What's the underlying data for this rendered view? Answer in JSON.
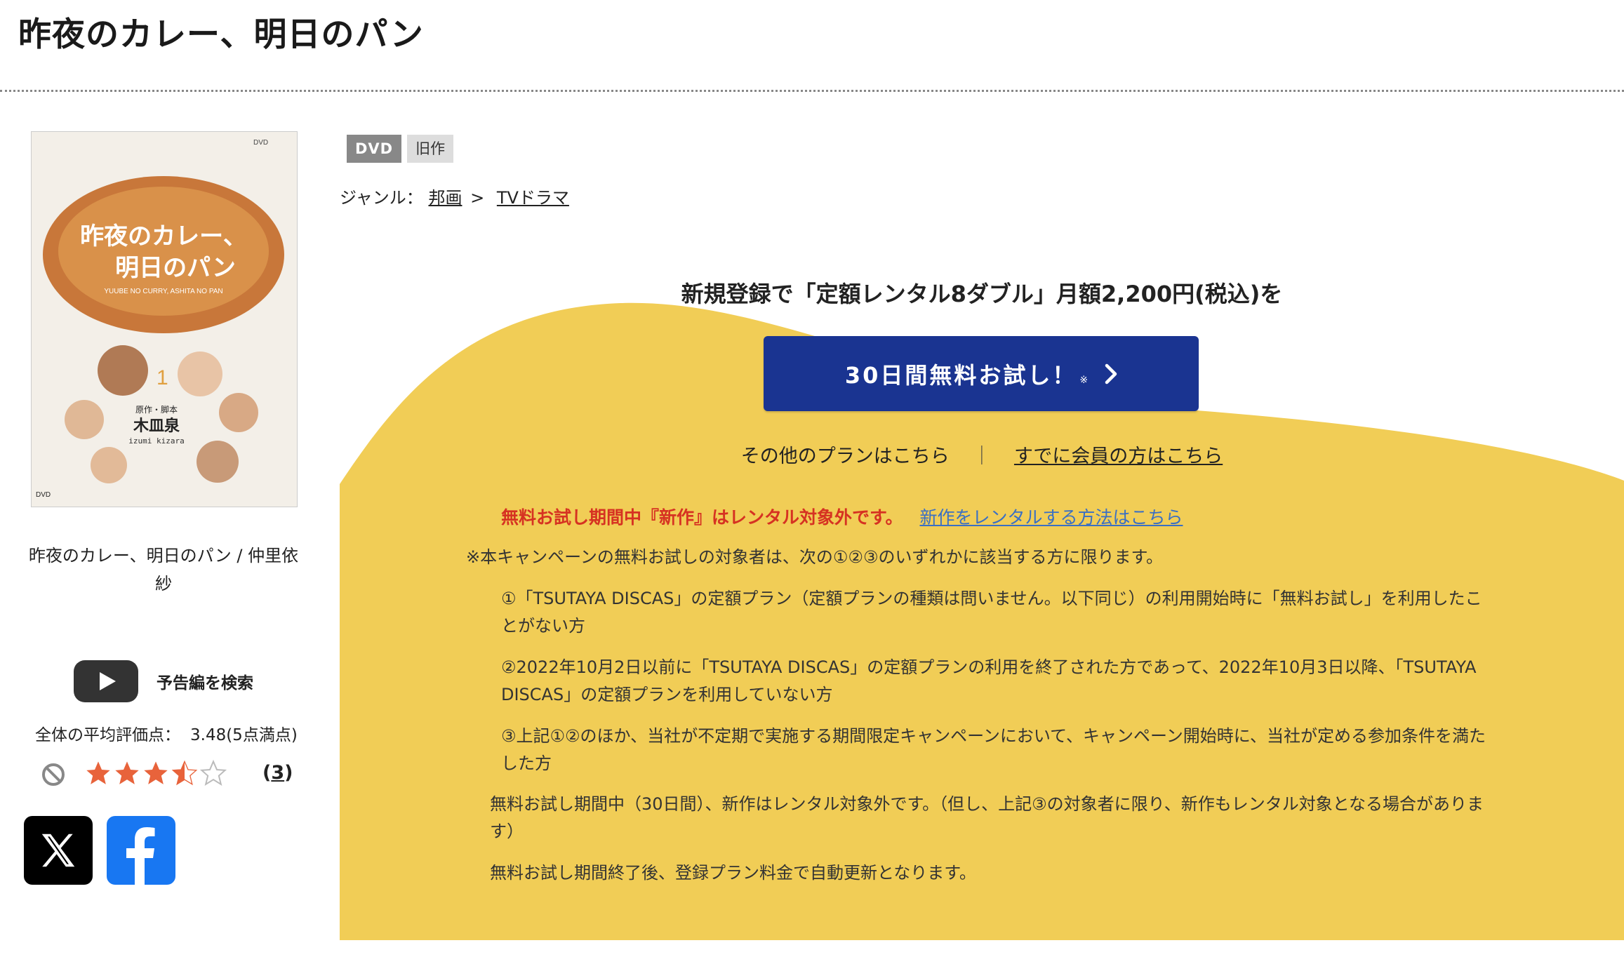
{
  "page": {
    "title": "昨夜のカレー、明日のパン"
  },
  "product": {
    "cover": {
      "title_art": "昨夜のカレー、明日のパン",
      "romaji": "YUUBE NO CURRY, ASHITA NO PAN",
      "volume": "1",
      "author_role": "原作・脚本",
      "author": "木皿泉",
      "author_romaji": "izumi kizara",
      "label": "DVD"
    },
    "name": "昨夜のカレー、明日のパン / 仲里依紗",
    "trailer_label": "予告編を検索",
    "rating": {
      "label": "全体の平均評価点：",
      "value": "3.48(5点満点)",
      "stars_value": 3.5,
      "review_count": "3"
    },
    "share": {
      "x_icon": "x-logo",
      "facebook_icon": "facebook-logo"
    }
  },
  "badges": {
    "format": "DVD",
    "category": "旧作"
  },
  "genre": {
    "label": "ジャンル：",
    "level1": "邦画",
    "separator": ">",
    "level2": "TVドラマ"
  },
  "promo": {
    "headline": "新規登録で「定額レンタル8ダブル」月額2,200円(税込)を",
    "trial_button": "30日間無料お試し！",
    "trial_note": "※",
    "other_plans": "その他のプランはこちら",
    "link_divider": "｜",
    "member_link": "すでに会員の方はこちら",
    "warning_text": "無料お試し期間中『新作』はレンタル対象外です。",
    "warning_link": "新作をレンタルする方法はこちら",
    "conditions_intro": "※本キャンペーンの無料お試しの対象者は、次の①②③のいずれかに該当する方に限ります。",
    "conditions": [
      "①「TSUTAYA DISCAS」の定額プラン（定額プランの種類は問いません。以下同じ）の利用開始時に「無料お試し」を利用したことがない方",
      "②2022年10月2日以前に「TSUTAYA DISCAS」の定額プランの利用を終了された方であって、2022年10月3日以降、「TSUTAYA DISCAS」の定額プランを利用していない方",
      "③上記①②のほか、当社が不定期で実施する期間限定キャンペーンにおいて、キャンペーン開始時に、当社が定める参加条件を満たした方"
    ],
    "note1": "無料お試し期間中（30日間）、新作はレンタル対象外です。（但し、上記③の対象者に限り、新作もレンタル対象となる場合があります）",
    "note2": "無料お試し期間終了後、登録プラン料金で自動更新となります。"
  },
  "colors": {
    "promo_yellow": "#f1cd56",
    "button_blue": "#1a3491",
    "warning_red": "#d63222",
    "link_blue": "#3a6fc4",
    "star_orange": "#e8633b"
  }
}
